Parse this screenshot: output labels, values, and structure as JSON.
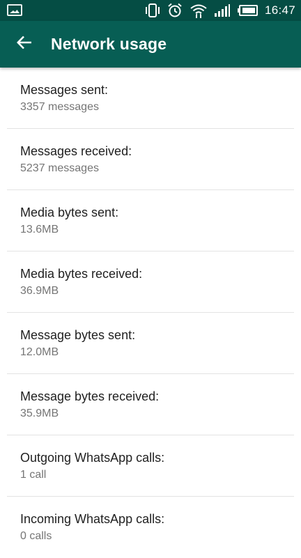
{
  "status_bar": {
    "time": "16:47",
    "icons": [
      "gallery-icon",
      "vibrate-icon",
      "alarm-icon",
      "wifi-icon",
      "signal-icon",
      "battery-icon"
    ]
  },
  "app_bar": {
    "title": "Network usage",
    "back_icon": "back-arrow-icon",
    "color": "#075e54"
  },
  "items": [
    {
      "label": "Messages sent:",
      "value": "3357 messages"
    },
    {
      "label": "Messages received:",
      "value": "5237 messages"
    },
    {
      "label": "Media bytes sent:",
      "value": "13.6MB"
    },
    {
      "label": "Media bytes received:",
      "value": "36.9MB"
    },
    {
      "label": "Message bytes sent:",
      "value": "12.0MB"
    },
    {
      "label": "Message bytes received:",
      "value": "35.9MB"
    },
    {
      "label": "Outgoing WhatsApp calls:",
      "value": "1 call"
    },
    {
      "label": "Incoming WhatsApp calls:",
      "value": "0 calls"
    }
  ]
}
